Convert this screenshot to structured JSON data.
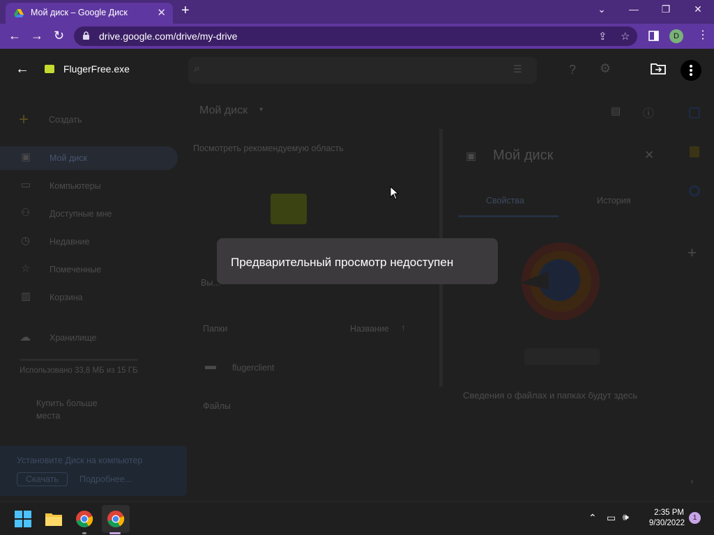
{
  "browser": {
    "tab_title": "Мой диск – Google Диск",
    "url": "drive.google.com/drive/my-drive",
    "profile_initial": "D",
    "accent": "#5f37a0"
  },
  "preview": {
    "filename": "FlugerFree.exe",
    "toast": "Предварительный просмотр недоступен"
  },
  "drive": {
    "create_label": "Создать",
    "nav": [
      {
        "label": "Мой диск",
        "icon": "my-drive-icon"
      },
      {
        "label": "Компьютеры",
        "icon": "computer-icon"
      },
      {
        "label": "Доступные мне",
        "icon": "people-icon"
      },
      {
        "label": "Недавние",
        "icon": "clock-icon"
      },
      {
        "label": "Помеченные",
        "icon": "star-icon"
      },
      {
        "label": "Корзина",
        "icon": "trash-icon"
      }
    ],
    "storage_label": "Хранилище",
    "storage_used": "Использовано 33,8 МБ из 15 ГБ",
    "buy_storage": "Купить больше места",
    "install_banner": "Установите Диск на компьютер",
    "download_btn": "Скачать",
    "more_btn": "Подробнее...",
    "breadcrumb": "Мой диск",
    "recommended": "Посмотреть рекомендуемую область",
    "suggested_file": "Вы...",
    "folders_header": "Папки",
    "sort_label": "Название",
    "folder_name": "flugerclient",
    "files_header": "Файлы",
    "details_title": "Мой диск",
    "tab_properties": "Свойства",
    "tab_history": "История",
    "details_empty": "Сведения о файлах и папках будут здесь"
  },
  "taskbar": {
    "time": "2:35 PM",
    "date": "9/30/2022",
    "notifications": "1"
  }
}
